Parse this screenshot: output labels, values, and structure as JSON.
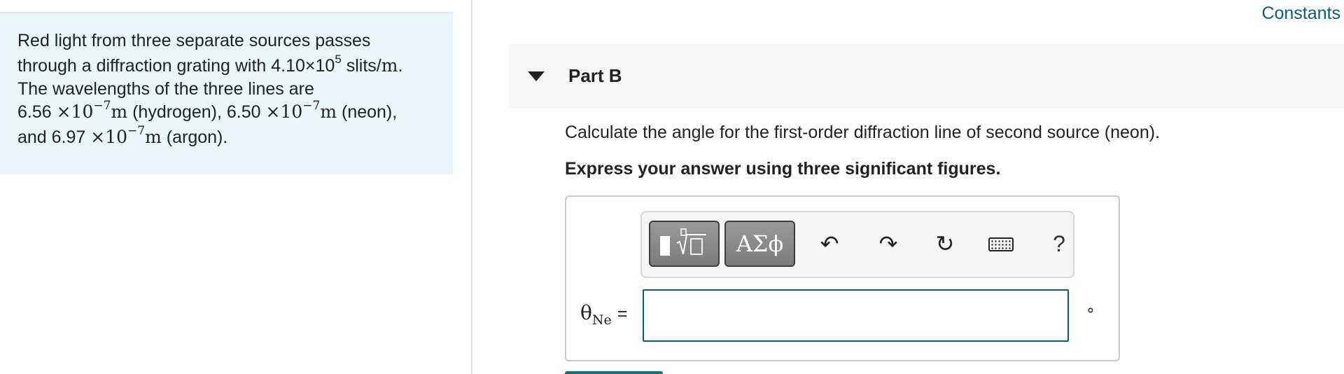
{
  "problem": {
    "line1": "Red light from three separate sources passes",
    "line2_pre": "through a diffraction grating with 4.10×10",
    "line2_exp": "5",
    "line2_post": " slits/",
    "line2_unit": "m",
    "line2_end": ".",
    "line3": "The wavelengths of the three lines are",
    "line4_v1": "6.56 ",
    "line4_times1": "×10",
    "line4_exp1": "−7",
    "line4_u1": "m",
    "line4_t1": " (hydrogen), 6.50 ",
    "line4_times2": "×10",
    "line4_exp2": "−7",
    "line4_u2": "m",
    "line4_t2": " (neon),",
    "line5_v": "and 6.97 ",
    "line5_times": "×10",
    "line5_exp": "−7",
    "line5_u": "m",
    "line5_t": " (argon)."
  },
  "header": {
    "constants_link": "Constants"
  },
  "part": {
    "title": "Part B",
    "question": "Calculate the angle for the first-order diffraction line of second source (neon).",
    "instruction": "Express your answer using three significant figures."
  },
  "toolbar": {
    "greek_label": "ΑΣϕ",
    "help_label": "?",
    "undo_glyph": "↶",
    "redo_glyph": "↷",
    "reset_glyph": "↻"
  },
  "answer": {
    "var_symbol": "θ",
    "var_sub": "Ne",
    "equals": "=",
    "value": "",
    "placeholder": "",
    "unit": "∘"
  },
  "icons": {
    "templates": "templates-icon",
    "undo": "undo-icon",
    "redo": "redo-icon",
    "reset": "reset-icon",
    "keyboard": "keyboard-icon",
    "caret": "caret-down-icon"
  },
  "colors": {
    "problem_bg": "#e8f6f7",
    "link": "#0b5e7a",
    "input_border": "#0b5e7a",
    "toolbar_button": "#8a8a8a"
  }
}
